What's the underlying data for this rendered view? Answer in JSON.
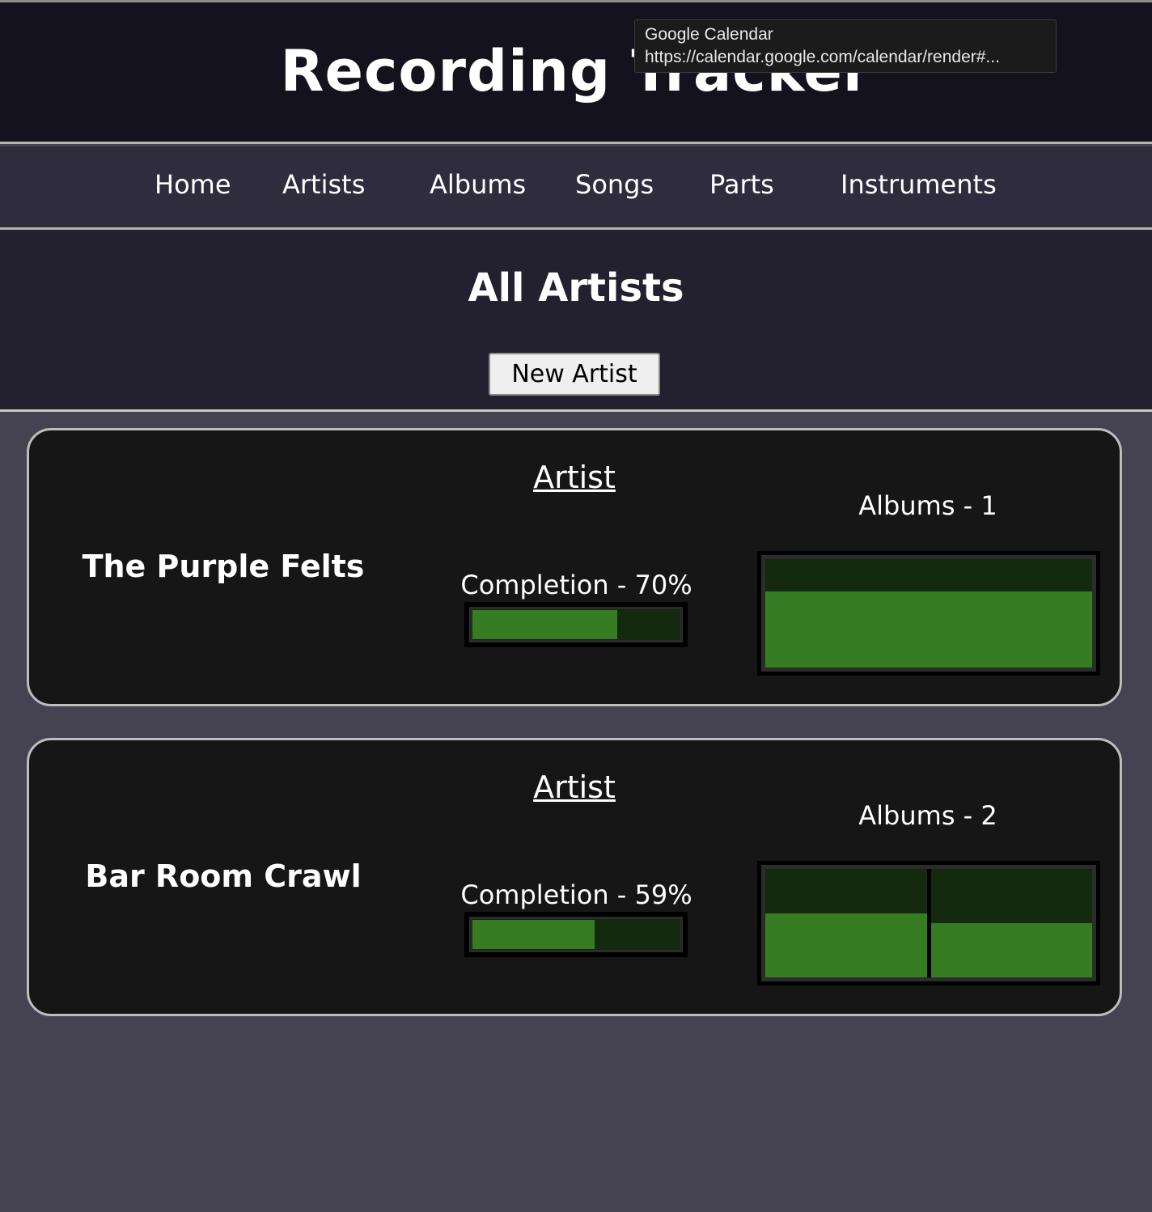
{
  "header": {
    "title": "Recording Tracker"
  },
  "tooltip": {
    "title": "Google Calendar",
    "url": "https://calendar.google.com/calendar/render#..."
  },
  "nav": {
    "items": [
      {
        "label": "Home"
      },
      {
        "label": "Artists"
      },
      {
        "label": "Albums"
      },
      {
        "label": "Songs"
      },
      {
        "label": "Parts"
      },
      {
        "label": "Instruments"
      }
    ]
  },
  "page": {
    "title": "All Artists",
    "new_button_label": "New Artist"
  },
  "colors": {
    "progress_fill": "#357c23",
    "progress_empty": "#132a0f"
  },
  "artists": [
    {
      "heading": "Artist",
      "name": "The Purple Felts",
      "completion_label": "Completion - 70%",
      "completion": 0.7,
      "albums_label": "Albums - 1",
      "album_progress": [
        0.7
      ]
    },
    {
      "heading": "Artist",
      "name": "Bar Room Crawl",
      "completion_label": "Completion - 59%",
      "completion": 0.59,
      "albums_label": "Albums - 2",
      "album_progress": [
        0.59,
        0.5
      ]
    }
  ]
}
